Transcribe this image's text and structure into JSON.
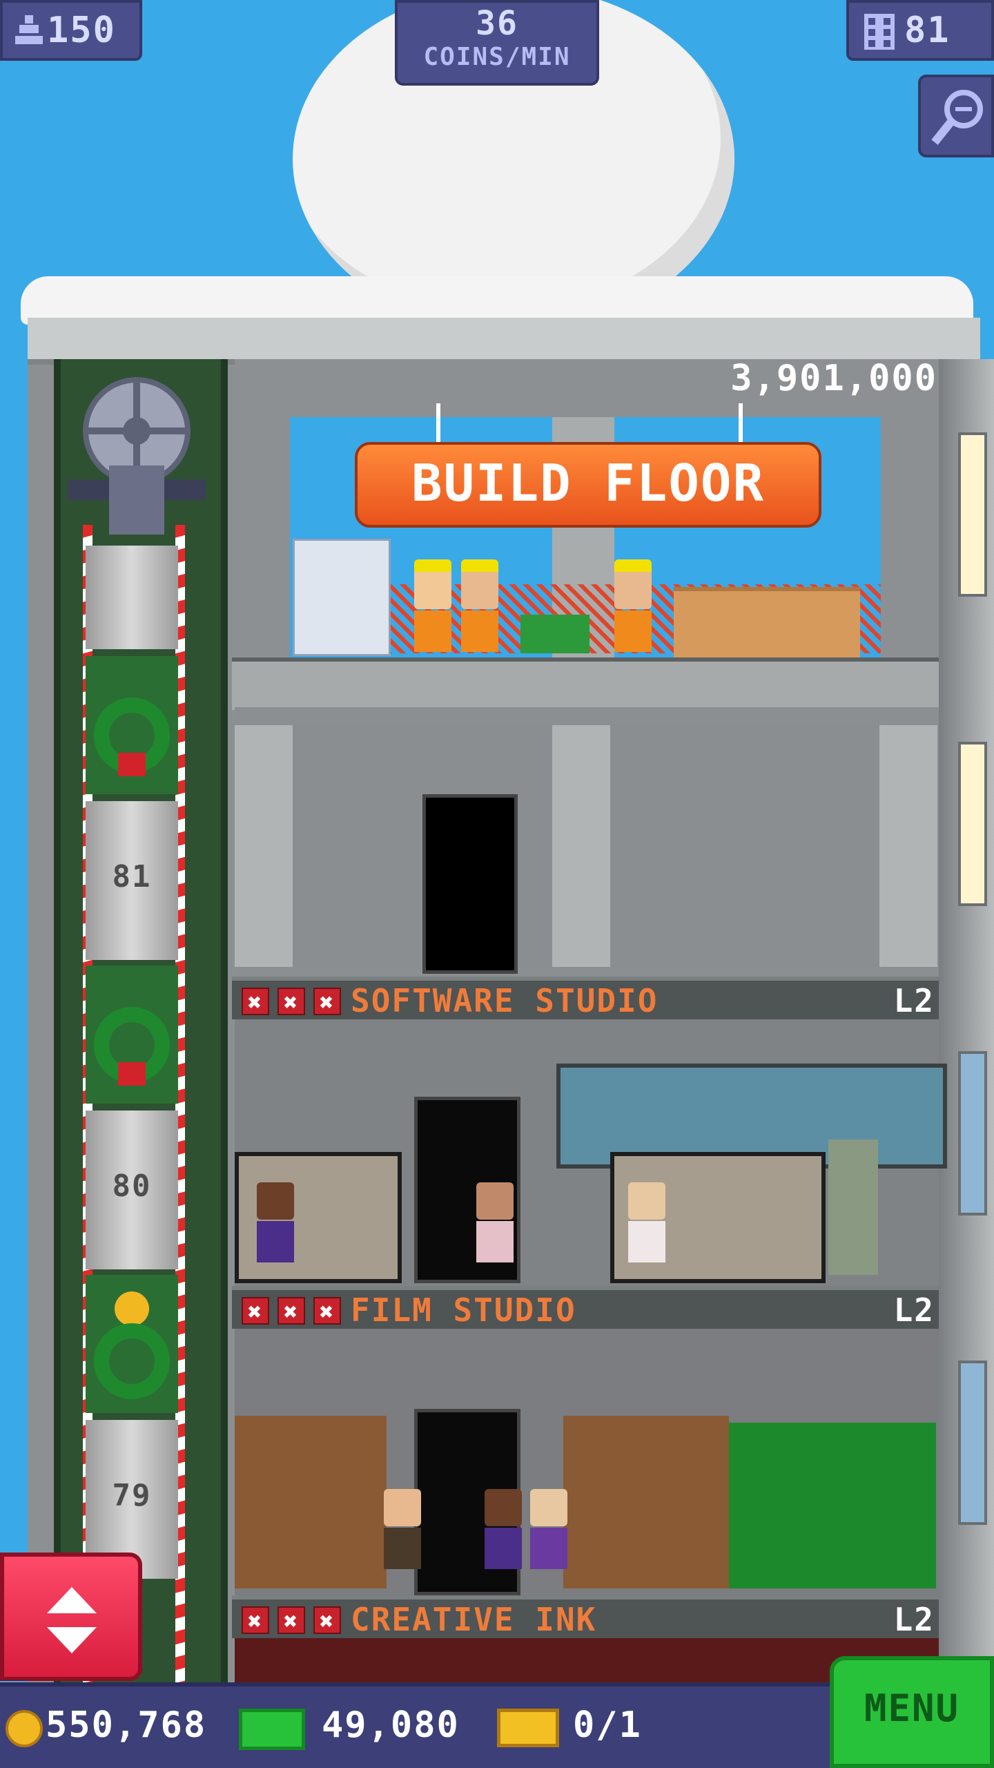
{
  "hud": {
    "population": "150",
    "coins_per_min_value": "36",
    "coins_per_min_label": "COINS/MIN",
    "floor_count": "81"
  },
  "build": {
    "cost": "3,901,000",
    "button_label": "BUILD FLOOR"
  },
  "elevator": {
    "floor_numbers": [
      "81",
      "80",
      "79"
    ]
  },
  "floors": [
    {
      "name": "SOFTWARE STUDIO",
      "level": "L2"
    },
    {
      "name": "FILM STUDIO",
      "level": "L2"
    },
    {
      "name": "CREATIVE INK",
      "level": "L2"
    }
  ],
  "bottom": {
    "coins": "550,768",
    "bux": "49,080",
    "tickets": "0/1",
    "menu_label": "MENU"
  },
  "colors": {
    "sky": "#3aa9e8",
    "hud": "#4a4f8c",
    "build_button": "#f26a2a",
    "menu": "#27c23a",
    "floor_name": "#f07c3a"
  }
}
